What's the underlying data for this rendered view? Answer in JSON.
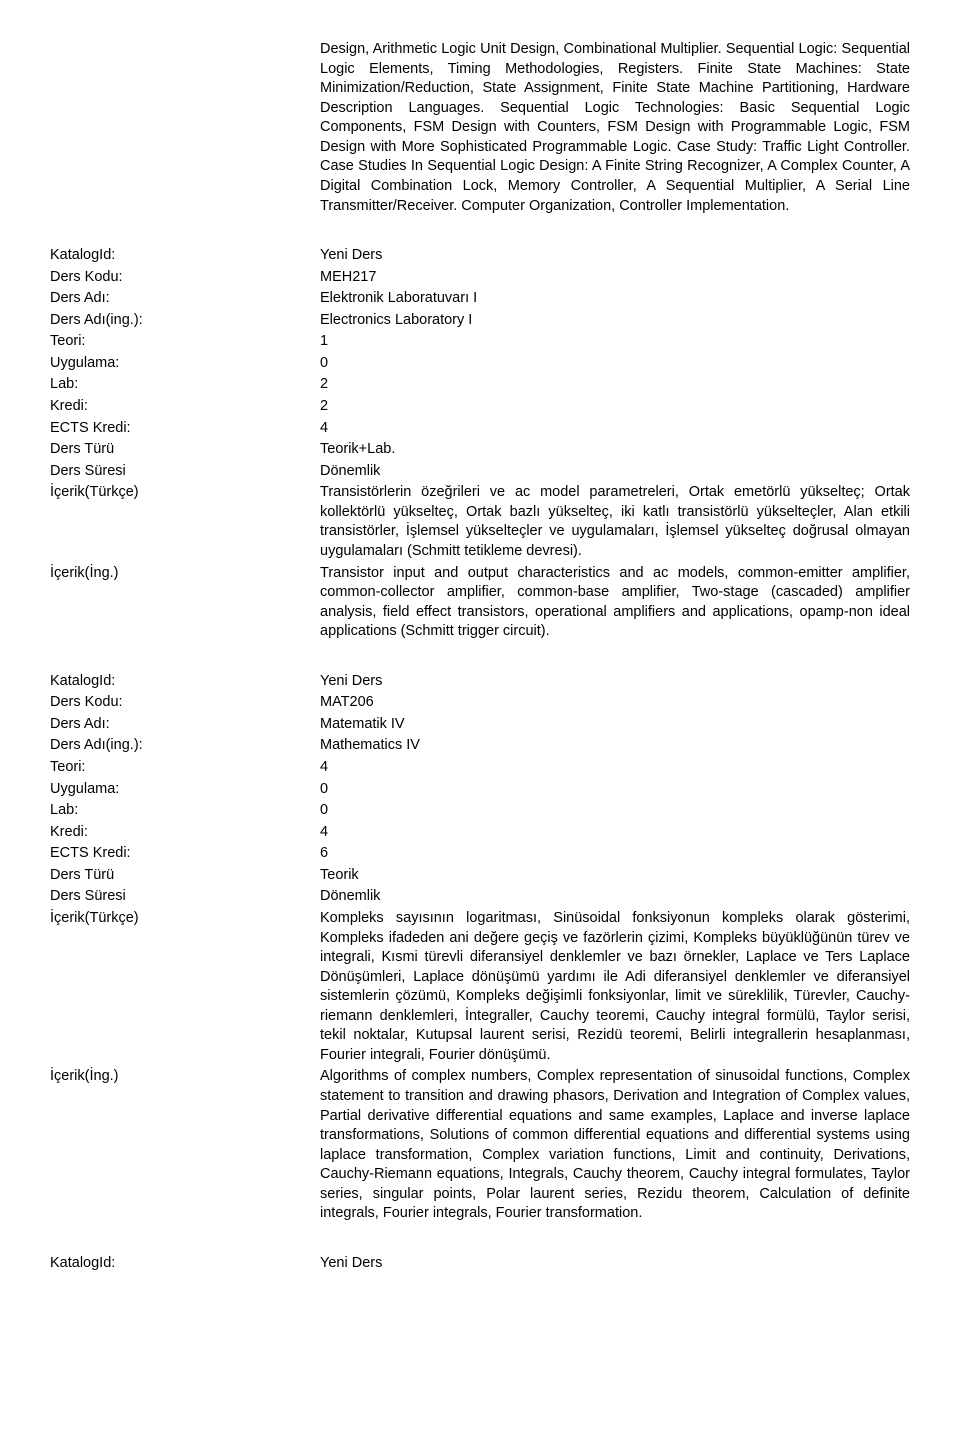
{
  "topParagraph": "Design, Arithmetic Logic Unit Design, Combinational Multiplier. Sequential Logic: Sequential Logic Elements, Timing Methodologies, Registers. Finite State Machines: State Minimization/Reduction, State Assignment, Finite State Machine Partitioning, Hardware Description Languages. Sequential Logic Technologies: Basic Sequential Logic Components, FSM Design with Counters, FSM Design with Programmable Logic, FSM Design with More Sophisticated Programmable Logic. Case Study: Traffic Light Controller. Case Studies In Sequential Logic Design: A Finite String Recognizer, A Complex Counter, A Digital Combination Lock, Memory Controller, A Sequential Multiplier, A Serial Line Transmitter/Receiver. Computer Organization, Controller Implementation.",
  "labels": {
    "katalogId": "KatalogId:",
    "dersKodu": "Ders Kodu:",
    "dersAdi": "Ders Adı:",
    "dersAdiIng": "Ders Adı(ing.):",
    "teori": "Teori:",
    "uygulama": "Uygulama:",
    "lab": "Lab:",
    "kredi": "Kredi:",
    "ectsKredi": "ECTS Kredi:",
    "dersTuru": "Ders Türü",
    "dersSuresi": "Ders Süresi",
    "icerikTr": "İçerik(Türkçe)",
    "icerikEn": "İçerik(İng.)"
  },
  "course1": {
    "katalogId": "Yeni Ders",
    "dersKodu": "MEH217",
    "dersAdi": "Elektronik Laboratuvarı I",
    "dersAdiIng": "Electronics Laboratory I",
    "teori": "1",
    "uygulama": "0",
    "lab": "2",
    "kredi": "2",
    "ectsKredi": "4",
    "dersTuru": "Teorik+Lab.",
    "dersSuresi": "Dönemlik",
    "icerikTr": "Transistörlerin özeğrileri ve ac model parametreleri, Ortak emetörlü yükselteç; Ortak kollektörlü yükselteç, Ortak bazlı yükselteç, iki katlı transistörlü yükselteçler, Alan etkili transistörler, İşlemsel yükselteçler ve uygulamaları, İşlemsel yükselteç doğrusal olmayan uygulamaları (Schmitt tetikleme devresi).",
    "icerikEn": "Transistor input and output characteristics and ac models, common-emitter amplifier, common-collector amplifier, common-base amplifier, Two-stage (cascaded) amplifier analysis, field effect transistors, operational amplifiers and applications, opamp-non ideal applications (Schmitt trigger circuit)."
  },
  "course2": {
    "katalogId": "Yeni Ders",
    "dersKodu": "MAT206",
    "dersAdi": "Matematik IV",
    "dersAdiIng": "Mathematics IV",
    "teori": "4",
    "uygulama": "0",
    "lab": "0",
    "kredi": "4",
    "ectsKredi": "6",
    "dersTuru": "Teorik",
    "dersSuresi": "Dönemlik",
    "icerikTr": "Kompleks sayısının logaritması, Sinüsoidal fonksiyonun kompleks olarak gösterimi, Kompleks ifadeden ani değere geçiş ve fazörlerin çizimi, Kompleks büyüklüğünün türev ve integrali, Kısmi türevli diferansiyel denklemler ve bazı örnekler, Laplace ve Ters Laplace Dönüşümleri, Laplace dönüşümü yardımı ile Adi diferansiyel denklemler ve diferansiyel sistemlerin çözümü, Kompleks değişimli fonksiyonlar, limit ve süreklilik, Türevler, Cauchy-riemann denklemleri, İntegraller, Cauchy teoremi, Cauchy integral formülü, Taylor serisi, tekil noktalar, Kutupsal laurent serisi, Rezidü teoremi, Belirli integrallerin hesaplanması, Fourier integrali, Fourier dönüşümü.",
    "icerikEn": "Algorithms of complex numbers, Complex representation of sinusoidal functions, Complex statement to transition and drawing phasors, Derivation and Integration of Complex values, Partial derivative differential equations and same examples, Laplace and inverse laplace transformations, Solutions of common differential equations and differential systems using laplace transformation, Complex variation functions, Limit and continuity, Derivations, Cauchy-Riemann equations, Integrals, Cauchy theorem, Cauchy integral formulates, Taylor series, singular points, Polar laurent series, Rezidu theorem, Calculation of definite integrals, Fourier integrals, Fourier transformation."
  },
  "trailing": {
    "katalogId": "Yeni Ders"
  }
}
